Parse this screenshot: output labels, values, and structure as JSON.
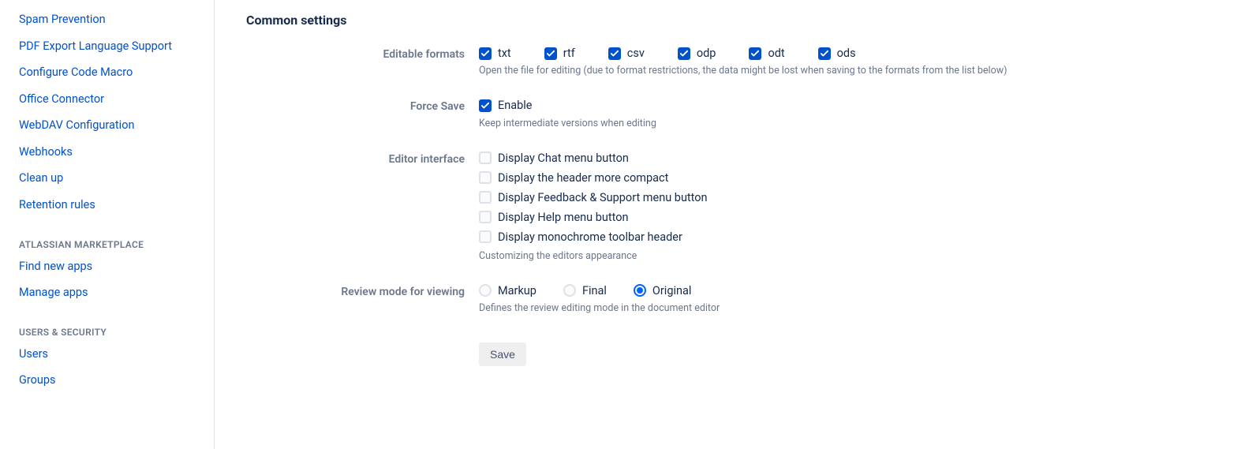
{
  "sidebar": {
    "groups": [
      {
        "heading": null,
        "items": [
          "Spam Prevention",
          "PDF Export Language Support",
          "Configure Code Macro",
          "Office Connector",
          "WebDAV Configuration",
          "Webhooks",
          "Clean up",
          "Retention rules"
        ]
      },
      {
        "heading": "ATLASSIAN MARKETPLACE",
        "items": [
          "Find new apps",
          "Manage apps"
        ]
      },
      {
        "heading": "USERS & SECURITY",
        "items": [
          "Users",
          "Groups"
        ]
      }
    ]
  },
  "main": {
    "title": "Common settings",
    "editable_formats": {
      "label": "Editable formats",
      "options": [
        {
          "value": "txt",
          "checked": true
        },
        {
          "value": "rtf",
          "checked": true
        },
        {
          "value": "csv",
          "checked": true
        },
        {
          "value": "odp",
          "checked": true
        },
        {
          "value": "odt",
          "checked": true
        },
        {
          "value": "ods",
          "checked": true
        }
      ],
      "help": "Open the file for editing (due to format restrictions, the data might be lost when saving to the formats from the list below)"
    },
    "force_save": {
      "label": "Force Save",
      "option": {
        "value": "Enable",
        "checked": true
      },
      "help": "Keep intermediate versions when editing"
    },
    "editor_interface": {
      "label": "Editor interface",
      "options": [
        {
          "value": "Display Chat menu button",
          "checked": false
        },
        {
          "value": "Display the header more compact",
          "checked": false
        },
        {
          "value": "Display Feedback & Support menu button",
          "checked": false
        },
        {
          "value": "Display Help menu button",
          "checked": false
        },
        {
          "value": "Display monochrome toolbar header",
          "checked": false
        }
      ],
      "help": "Customizing the editors appearance"
    },
    "review_mode": {
      "label": "Review mode for viewing",
      "options": [
        {
          "value": "Markup",
          "selected": false
        },
        {
          "value": "Final",
          "selected": false
        },
        {
          "value": "Original",
          "selected": true
        }
      ],
      "help": "Defines the review editing mode in the document editor"
    },
    "save_button": "Save"
  }
}
